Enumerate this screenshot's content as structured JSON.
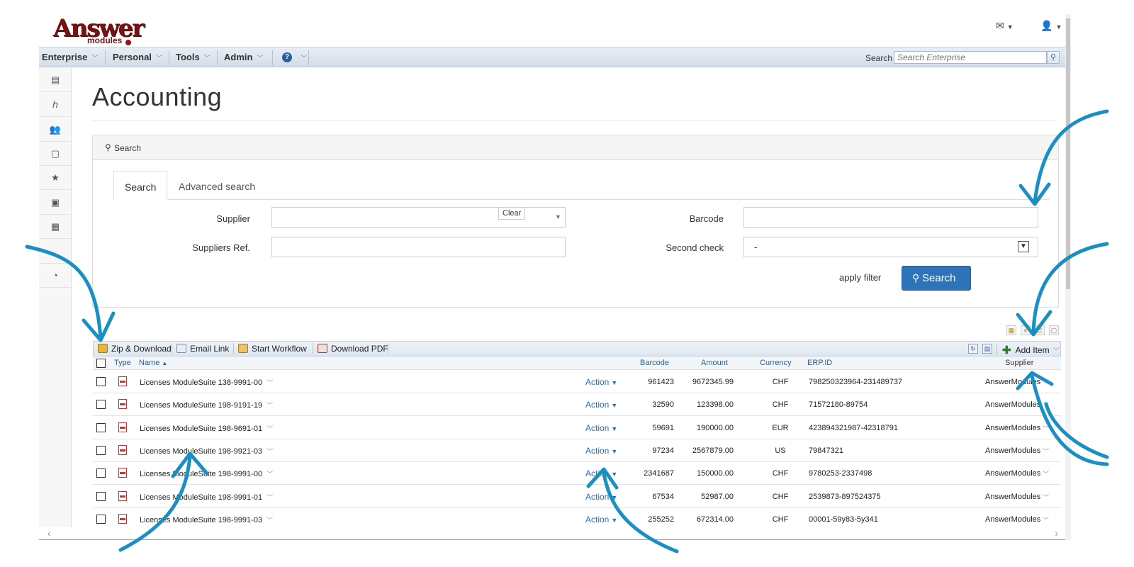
{
  "app": {
    "logo_main": "Answer",
    "logo_sub": "modules"
  },
  "header_icons": [
    "envelope-icon",
    "user-icon"
  ],
  "menu": [
    {
      "label": "Enterprise"
    },
    {
      "label": "Personal"
    },
    {
      "label": "Tools"
    },
    {
      "label": "Admin"
    }
  ],
  "top_search": {
    "label": "Search",
    "placeholder": "Search Enterprise"
  },
  "sidebar_icons": [
    "document-icon",
    "workflow-icon",
    "users-icon",
    "page-icon",
    "star-icon",
    "briefcase-icon",
    "calendar-icon",
    "dashboard-icon"
  ],
  "page": {
    "title": "Accounting",
    "panel_title": "Search"
  },
  "tabs": [
    {
      "label": "Search",
      "active": true
    },
    {
      "label": "Advanced search",
      "active": false
    }
  ],
  "form": {
    "supplier_label": "Supplier",
    "supplier_value": "",
    "clear_label": "Clear",
    "suppliers_ref_label": "Suppliers Ref.",
    "suppliers_ref_value": "",
    "barcode_label": "Barcode",
    "barcode_value": "",
    "second_check_label": "Second check",
    "second_check_value": "-",
    "apply_filter_label": "apply filter",
    "search_button": "Search"
  },
  "toolbar": {
    "zip": "Zip & Download",
    "email": "Email Link",
    "workflow": "Start Workflow",
    "pdf": "Download PDF",
    "add_item": "Add Item"
  },
  "columns": {
    "type": "Type",
    "name": "Name",
    "barcode": "Barcode",
    "amount": "Amount",
    "currency": "Currency",
    "erp": "ERP.ID",
    "supplier": "Supplier"
  },
  "rows": [
    {
      "name": "Licenses ModuleSuite 138-9991-00",
      "action": "Action",
      "barcode": "961423",
      "amount": "9672345.99",
      "currency": "CHF",
      "erp": "798250323964-231489737",
      "supplier": "AnswerModules"
    },
    {
      "name": "Licenses ModuleSuite 198-9191-19",
      "action": "Action",
      "barcode": "32590",
      "amount": "123398.00",
      "currency": "CHF",
      "erp": "71572180-89754",
      "supplier": "AnswerModules"
    },
    {
      "name": "Licenses ModuleSuite 198-9691-01",
      "action": "Action",
      "barcode": "59691",
      "amount": "190000.00",
      "currency": "EUR",
      "erp": "423894321987-42318791",
      "supplier": "AnswerModules"
    },
    {
      "name": "Licenses ModuleSuite 198-9921-03",
      "action": "Action",
      "barcode": "97234",
      "amount": "2567879.00",
      "currency": "US",
      "erp": "79847321",
      "supplier": "AnswerModules"
    },
    {
      "name": "Licenses ModuleSuite 198-9991-00",
      "action": "Action",
      "barcode": "2341687",
      "amount": "150000.00",
      "currency": "CHF",
      "erp": "9780253-2337498",
      "supplier": "AnswerModules"
    },
    {
      "name": "Licenses ModuleSuite 198-9991-01",
      "action": "Action",
      "barcode": "67534",
      "amount": "52987.00",
      "currency": "CHF",
      "erp": "2539873-897524375",
      "supplier": "AnswerModules"
    },
    {
      "name": "Licenses ModuleSuite 198-9991-03",
      "action": "Action",
      "barcode": "255252",
      "amount": "672314.00",
      "currency": "CHF",
      "erp": "00001-59y83-5y341",
      "supplier": "AnswerModules"
    }
  ],
  "colors": {
    "accent": "#2e73b8",
    "annotation_arrow": "#1a8fc4",
    "logo": "#7a1010"
  }
}
